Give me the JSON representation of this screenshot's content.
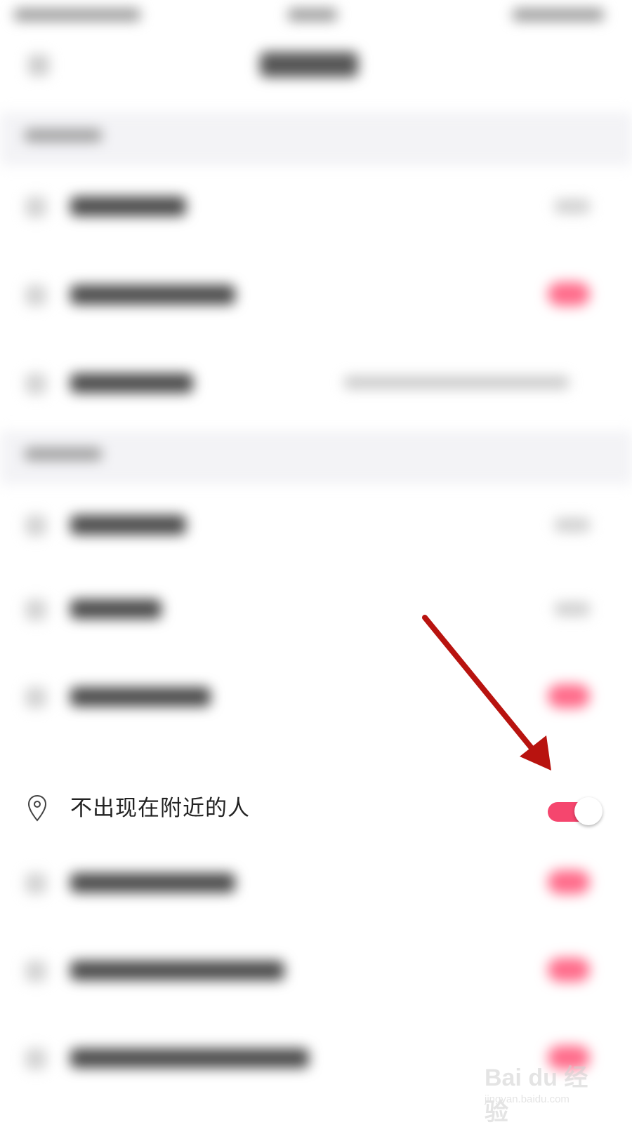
{
  "setting_row": {
    "label": "不出现在附近的人",
    "icon": "location-pin-icon",
    "toggle_on": true
  },
  "colors": {
    "toggle_accent": "#f5466e",
    "arrow": "#b8130f"
  },
  "watermark": {
    "brand": "Bai du 经验",
    "url": "jingyan.baidu.com"
  }
}
